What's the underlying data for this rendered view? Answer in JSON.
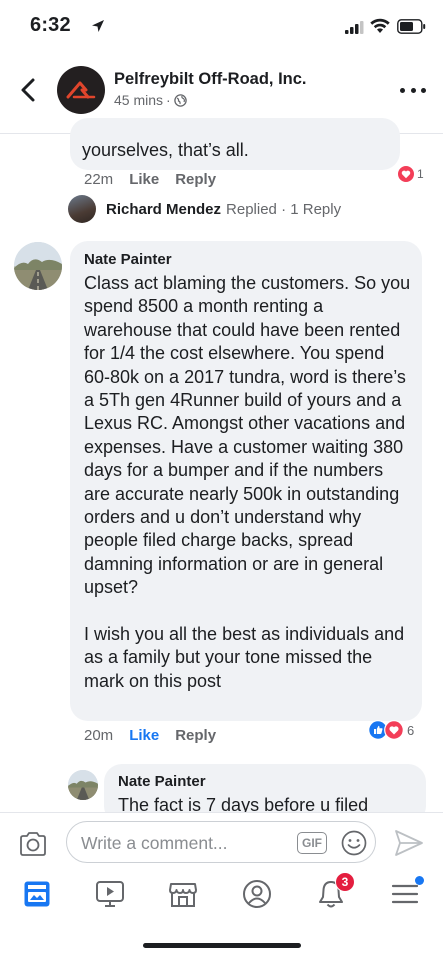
{
  "status_bar": {
    "time": "6:32"
  },
  "header": {
    "page_name": "Pelfreybilt Off-Road, Inc.",
    "post_time": "45 mins",
    "separator": "·"
  },
  "comment_prev": {
    "text": "yourselves, that’s all.",
    "time": "22m",
    "like_label": "Like",
    "reply_label": "Reply",
    "reaction_count": "1",
    "reply_summary": {
      "name": "Richard Mendez",
      "text": "Replied · 1 Reply"
    }
  },
  "comment_main": {
    "author": "Nate Painter",
    "paragraph1": "Class act blaming the customers. So you spend 8500 a month renting a warehouse that could have been rented for 1/4 the cost elsewhere. You spend 60-80k on a 2017 tundra, word is there’s a 5Th gen 4Runner build of yours and a Lexus RC. Amongst other vacations and expenses. Have a customer waiting 380 days for a bumper and if the numbers are accurate nearly 500k in outstanding orders and u don’t understand why people filed charge backs, spread damning information or are in general upset?",
    "paragraph2": "I wish you all the best as individuals and as a family but your tone missed the mark on this post",
    "time": "20m",
    "like_label": "Like",
    "reply_label": "Reply",
    "reaction_count": "6"
  },
  "comment_reply": {
    "author": "Nate Painter",
    "text": "The fact is 7 days before u filed"
  },
  "composer": {
    "placeholder": "Write a comment...",
    "gif_label": "GIF"
  },
  "tab_bar": {
    "notifications_badge": "3"
  },
  "colors": {
    "accent": "#1877f2",
    "bubble": "#f0f2f5",
    "secondary_text": "#65676b",
    "love": "#f33e58",
    "badge": "#e41e3f"
  },
  "icons": [
    "back-arrow-icon",
    "globe-icon",
    "more-icon",
    "heart-icon",
    "thumbs-up-icon",
    "camera-icon",
    "gif-icon",
    "emoji-icon",
    "send-icon",
    "news-feed-icon",
    "watch-icon",
    "marketplace-icon",
    "profile-icon",
    "bell-icon",
    "menu-icon"
  ]
}
